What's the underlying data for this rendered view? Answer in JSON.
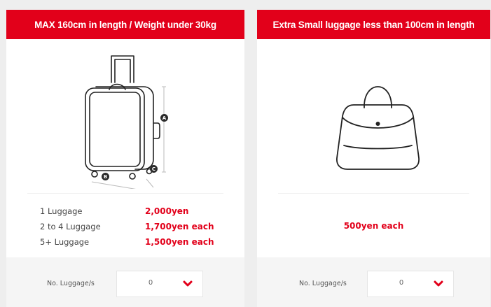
{
  "colors": {
    "accent": "#e2001a",
    "background": "#eeeeee",
    "footer": "#f5f5f5"
  },
  "regular_luggage": {
    "header": "MAX 160cm in length / Weight under 30kg",
    "illustration": "suitcase-icon",
    "dimension_markers": [
      "A",
      "B",
      "C"
    ],
    "prices": [
      {
        "label": "1 Luggage",
        "value": "2,000yen"
      },
      {
        "label": "2 to 4 Luggage",
        "value": "1,700yen each"
      },
      {
        "label": "5+ Luggage",
        "value": "1,500yen each"
      }
    ],
    "quantity": {
      "label": "No. Luggage/s",
      "value": "0",
      "icon": "chevron-down-icon"
    }
  },
  "small_luggage": {
    "header": "Extra Small luggage less than 100cm in length",
    "illustration": "handbag-icon",
    "price": "500yen each",
    "quantity": {
      "label": "No. Luggage/s",
      "value": "0",
      "icon": "chevron-down-icon"
    }
  }
}
